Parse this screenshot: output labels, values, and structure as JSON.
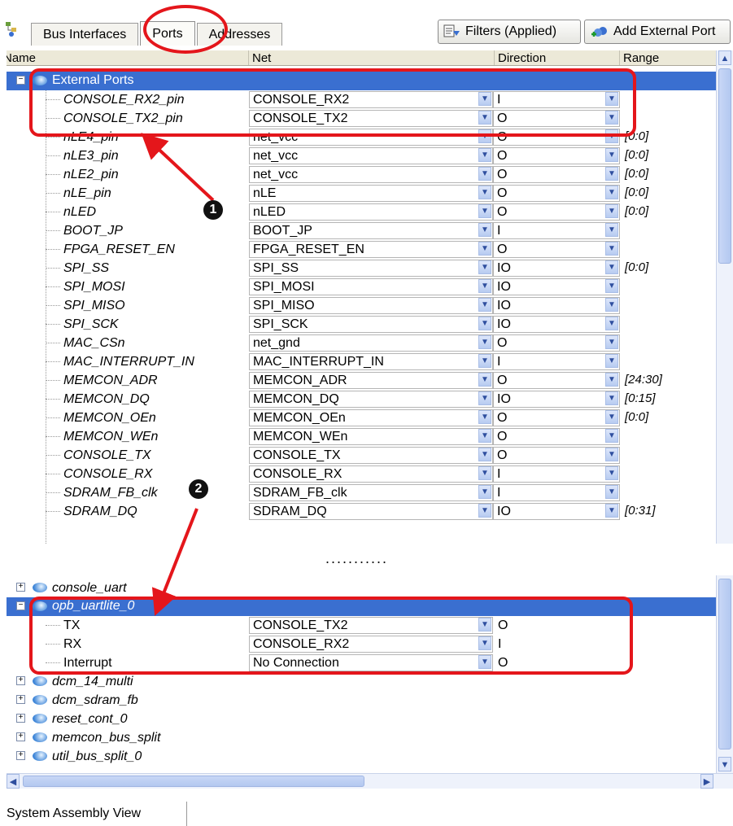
{
  "toolbar": {
    "tabs": [
      "Bus Interfaces",
      "Ports",
      "Addresses"
    ],
    "filters_label": "Filters (Applied)",
    "add_port_label": "Add External Port"
  },
  "headers": [
    "Name",
    "Net",
    "Direction",
    "Range"
  ],
  "external_group": "External Ports",
  "ports": [
    {
      "name": "CONSOLE_RX2_pin",
      "net": "CONSOLE_RX2",
      "dir": "I",
      "range": ""
    },
    {
      "name": "CONSOLE_TX2_pin",
      "net": "CONSOLE_TX2",
      "dir": "O",
      "range": ""
    },
    {
      "name": "nLE4_pin",
      "net": "net_vcc",
      "dir": "O",
      "range": "[0:0]"
    },
    {
      "name": "nLE3_pin",
      "net": "net_vcc",
      "dir": "O",
      "range": "[0:0]"
    },
    {
      "name": "nLE2_pin",
      "net": "net_vcc",
      "dir": "O",
      "range": "[0:0]"
    },
    {
      "name": "nLE_pin",
      "net": "nLE",
      "dir": "O",
      "range": "[0:0]"
    },
    {
      "name": "nLED",
      "net": "nLED",
      "dir": "O",
      "range": "[0:0]"
    },
    {
      "name": "BOOT_JP",
      "net": "BOOT_JP",
      "dir": "I",
      "range": ""
    },
    {
      "name": "FPGA_RESET_EN",
      "net": "FPGA_RESET_EN",
      "dir": "O",
      "range": ""
    },
    {
      "name": "SPI_SS",
      "net": "SPI_SS",
      "dir": "IO",
      "range": "[0:0]"
    },
    {
      "name": "SPI_MOSI",
      "net": "SPI_MOSI",
      "dir": "IO",
      "range": ""
    },
    {
      "name": "SPI_MISO",
      "net": "SPI_MISO",
      "dir": "IO",
      "range": ""
    },
    {
      "name": "SPI_SCK",
      "net": "SPI_SCK",
      "dir": "IO",
      "range": ""
    },
    {
      "name": "MAC_CSn",
      "net": "net_gnd",
      "dir": "O",
      "range": ""
    },
    {
      "name": "MAC_INTERRUPT_IN",
      "net": "MAC_INTERRUPT_IN",
      "dir": "I",
      "range": ""
    },
    {
      "name": "MEMCON_ADR",
      "net": "MEMCON_ADR",
      "dir": "O",
      "range": "[24:30]"
    },
    {
      "name": "MEMCON_DQ",
      "net": "MEMCON_DQ",
      "dir": "IO",
      "range": "[0:15]"
    },
    {
      "name": "MEMCON_OEn",
      "net": "MEMCON_OEn",
      "dir": "O",
      "range": "[0:0]"
    },
    {
      "name": "MEMCON_WEn",
      "net": "MEMCON_WEn",
      "dir": "O",
      "range": ""
    },
    {
      "name": "CONSOLE_TX",
      "net": "CONSOLE_TX",
      "dir": "O",
      "range": ""
    },
    {
      "name": "CONSOLE_RX",
      "net": "CONSOLE_RX",
      "dir": "I",
      "range": ""
    },
    {
      "name": "SDRAM_FB_clk",
      "net": "SDRAM_FB_clk",
      "dir": "I",
      "range": ""
    },
    {
      "name": "SDRAM_DQ",
      "net": "SDRAM_DQ",
      "dir": "IO",
      "range": "[0:31]"
    }
  ],
  "ellipsis": "...........",
  "instances_before": [
    "console_uart"
  ],
  "selected_instance": "opb_uartlite_0",
  "instance_ports": [
    {
      "name": "TX",
      "net": "CONSOLE_TX2",
      "dir": "O"
    },
    {
      "name": "RX",
      "net": "CONSOLE_RX2",
      "dir": "I"
    },
    {
      "name": "Interrupt",
      "net": "No Connection",
      "dir": "O"
    }
  ],
  "instances_after": [
    "dcm_14_multi",
    "dcm_sdram_fb",
    "reset_cont_0",
    "memcon_bus_split",
    "util_bus_split_0"
  ],
  "bottom_tab": "System Assembly View",
  "callouts": [
    "1",
    "2"
  ],
  "colors": {
    "accent": "#3a6fd0",
    "annotation": "#e4161b"
  }
}
